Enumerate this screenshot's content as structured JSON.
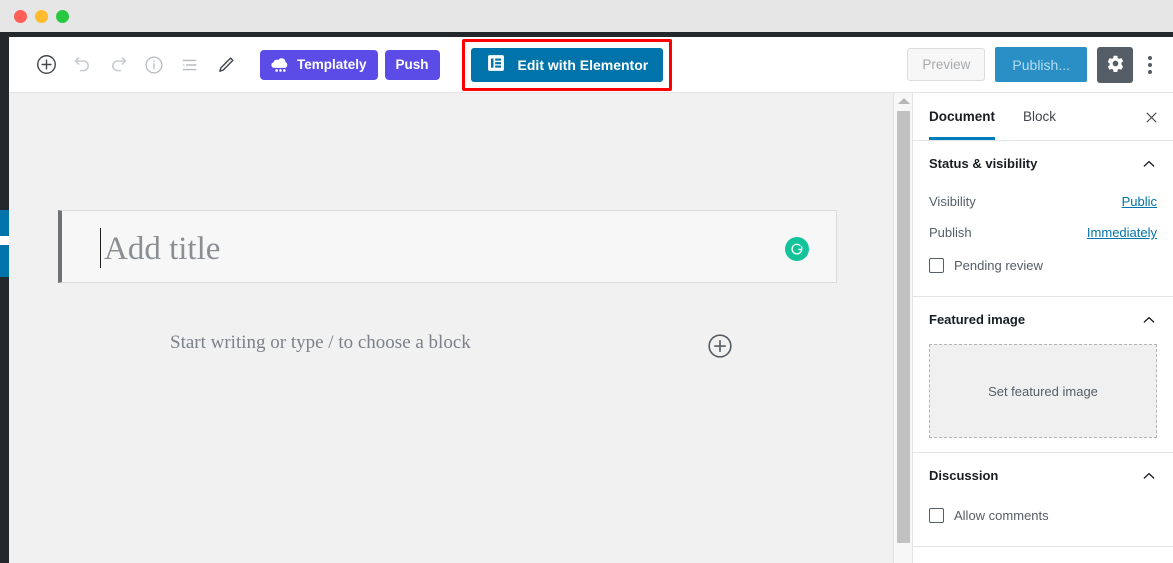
{
  "window": {
    "traffic_lights": [
      "close",
      "minimize",
      "zoom"
    ]
  },
  "toolbar": {
    "icons": [
      {
        "name": "add-block-icon",
        "label": "Add block"
      },
      {
        "name": "undo-icon",
        "label": "Undo"
      },
      {
        "name": "redo-icon",
        "label": "Redo"
      },
      {
        "name": "info-icon",
        "label": "Content structure"
      },
      {
        "name": "list-view-icon",
        "label": "Block navigation"
      },
      {
        "name": "edit-pencil-icon",
        "label": "Edit"
      }
    ],
    "templately_label": "Templately",
    "push_label": "Push",
    "elementor_label": "Edit with Elementor",
    "preview_label": "Preview",
    "publish_label": "Publish...",
    "settings_label": "Settings",
    "more_label": "More tools & options",
    "highlight_color": "#ff0000",
    "elementor_color": "#0073aa",
    "templately_color": "#5b4ce8",
    "publish_color": "#2a8fc4"
  },
  "editor": {
    "title_placeholder": "Add title",
    "title_value": "",
    "paragraph_placeholder": "Start writing or type / to choose a block",
    "grammarly_glyph": "G",
    "grammarly_color": "#15c39a"
  },
  "sidebar": {
    "tabs": [
      {
        "label": "Document",
        "active": true
      },
      {
        "label": "Block",
        "active": false
      }
    ],
    "close_label": "Close settings",
    "panels": [
      {
        "title": "Status & visibility",
        "rows": [
          {
            "label": "Visibility",
            "value": "Public"
          },
          {
            "label": "Publish",
            "value": "Immediately"
          }
        ],
        "checkbox": {
          "label": "Pending review",
          "checked": false
        }
      },
      {
        "title": "Featured image",
        "placeholder": "Set featured image"
      },
      {
        "title": "Discussion",
        "checkbox": {
          "label": "Allow comments",
          "checked": false
        }
      }
    ],
    "accent_color": "#007cba",
    "link_color": "#0073aa"
  }
}
